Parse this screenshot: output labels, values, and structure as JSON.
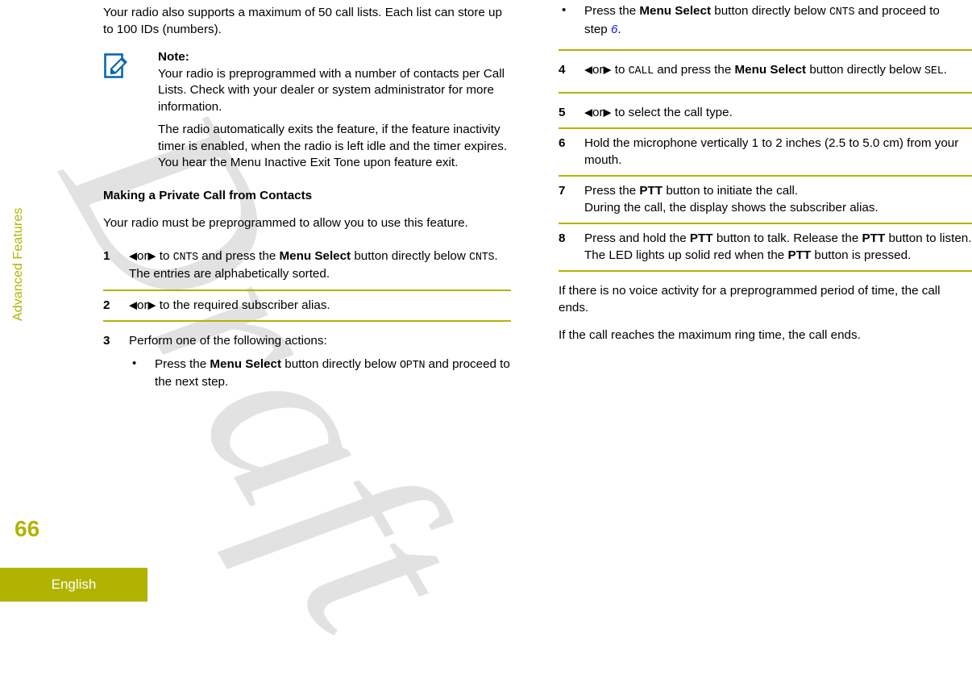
{
  "sidebar": {
    "chapter": "Advanced Features",
    "page_number": "66",
    "language": "English",
    "accent_color": "#b0b400"
  },
  "watermark": {
    "text": "Draft",
    "color": "#e2e2e2"
  },
  "icons": {
    "note": "note-pencil-icon"
  },
  "colors": {
    "rule": "#b0b400",
    "xref_link": "#1a1aff",
    "note_icon": "#0b66b0"
  },
  "left_column": {
    "intro": "Your radio also supports a maximum of 50 call lists. Each list can store up to 100 IDs (numbers).",
    "note": {
      "title": "Note:",
      "body": "Your radio is preprogrammed with a number of contacts per Call Lists. Check with your dealer or system administrator for more information.",
      "body2": "The radio automatically exits the feature, if the feature inactivity timer is enabled, when the radio is left idle and the timer expires. You hear the Menu Inactive Exit Tone upon feature exit."
    },
    "heading": "Making a Private Call from Contacts",
    "lead": "Your radio must be preprogrammed to allow you to use this feature.",
    "step1": {
      "num": "1",
      "arrow_left": "◀",
      "or": "or",
      "arrow_right": "▶",
      "t1": "to",
      "screen1": "CNTS",
      "t2": "and press the",
      "bold1": "Menu Select",
      "t3": "button directly below",
      "screen2": "CNTS",
      "t4": ".",
      "result": "The entries are alphabetically sorted."
    },
    "step2": {
      "num": "2",
      "arrow_left": "◀",
      "or": "or",
      "arrow_right": "▶",
      "t1": "to the required subscriber alias."
    },
    "step3": {
      "num": "3",
      "text": "Perform one of the following actions:",
      "bullet1": {
        "mark": "•",
        "t1": "Press the",
        "bold1": "Menu Select",
        "t2": "button directly below",
        "screen1": "OPTN",
        "t3": "and proceed to the next step."
      }
    }
  },
  "right_column": {
    "bullet2": {
      "mark": "•",
      "t1": "Press the",
      "bold1": "Menu Select",
      "t2": "button directly below",
      "screen1": "CNTS",
      "t3": "and proceed to step",
      "xref": "6",
      "t4": "."
    },
    "step4": {
      "num": "4",
      "arrow_left": "◀",
      "or": "or",
      "arrow_right": "▶",
      "t1": "to",
      "screen1": "CALL",
      "t2": "and press the",
      "bold1": "Menu Select",
      "t3": "button directly below",
      "screen2": "SEL",
      "t4": "."
    },
    "step5": {
      "num": "5",
      "arrow_left": "◀",
      "or": "or",
      "arrow_right": "▶",
      "t1": "to select the call type."
    },
    "step6": {
      "num": "6",
      "text": "Hold the microphone vertically 1 to 2 inches (2.5 to 5.0 cm) from your mouth."
    },
    "step7": {
      "num": "7",
      "t1": "Press the",
      "bold1": "PTT",
      "t2": "button to initiate the call.",
      "result": "During the call, the display shows the subscriber alias."
    },
    "step8": {
      "num": "8",
      "t1": "Press and hold the",
      "bold1": "PTT",
      "t2": "button to talk. Release the",
      "bold2": "PTT",
      "t3": "button to listen.",
      "r1": "The LED lights up solid red when the",
      "bold3": "PTT",
      "r2": "button is pressed."
    },
    "after1": "If there is no voice activity for a preprogrammed period of time, the call ends.",
    "after2": "If the call reaches the maximum ring time, the call ends."
  }
}
